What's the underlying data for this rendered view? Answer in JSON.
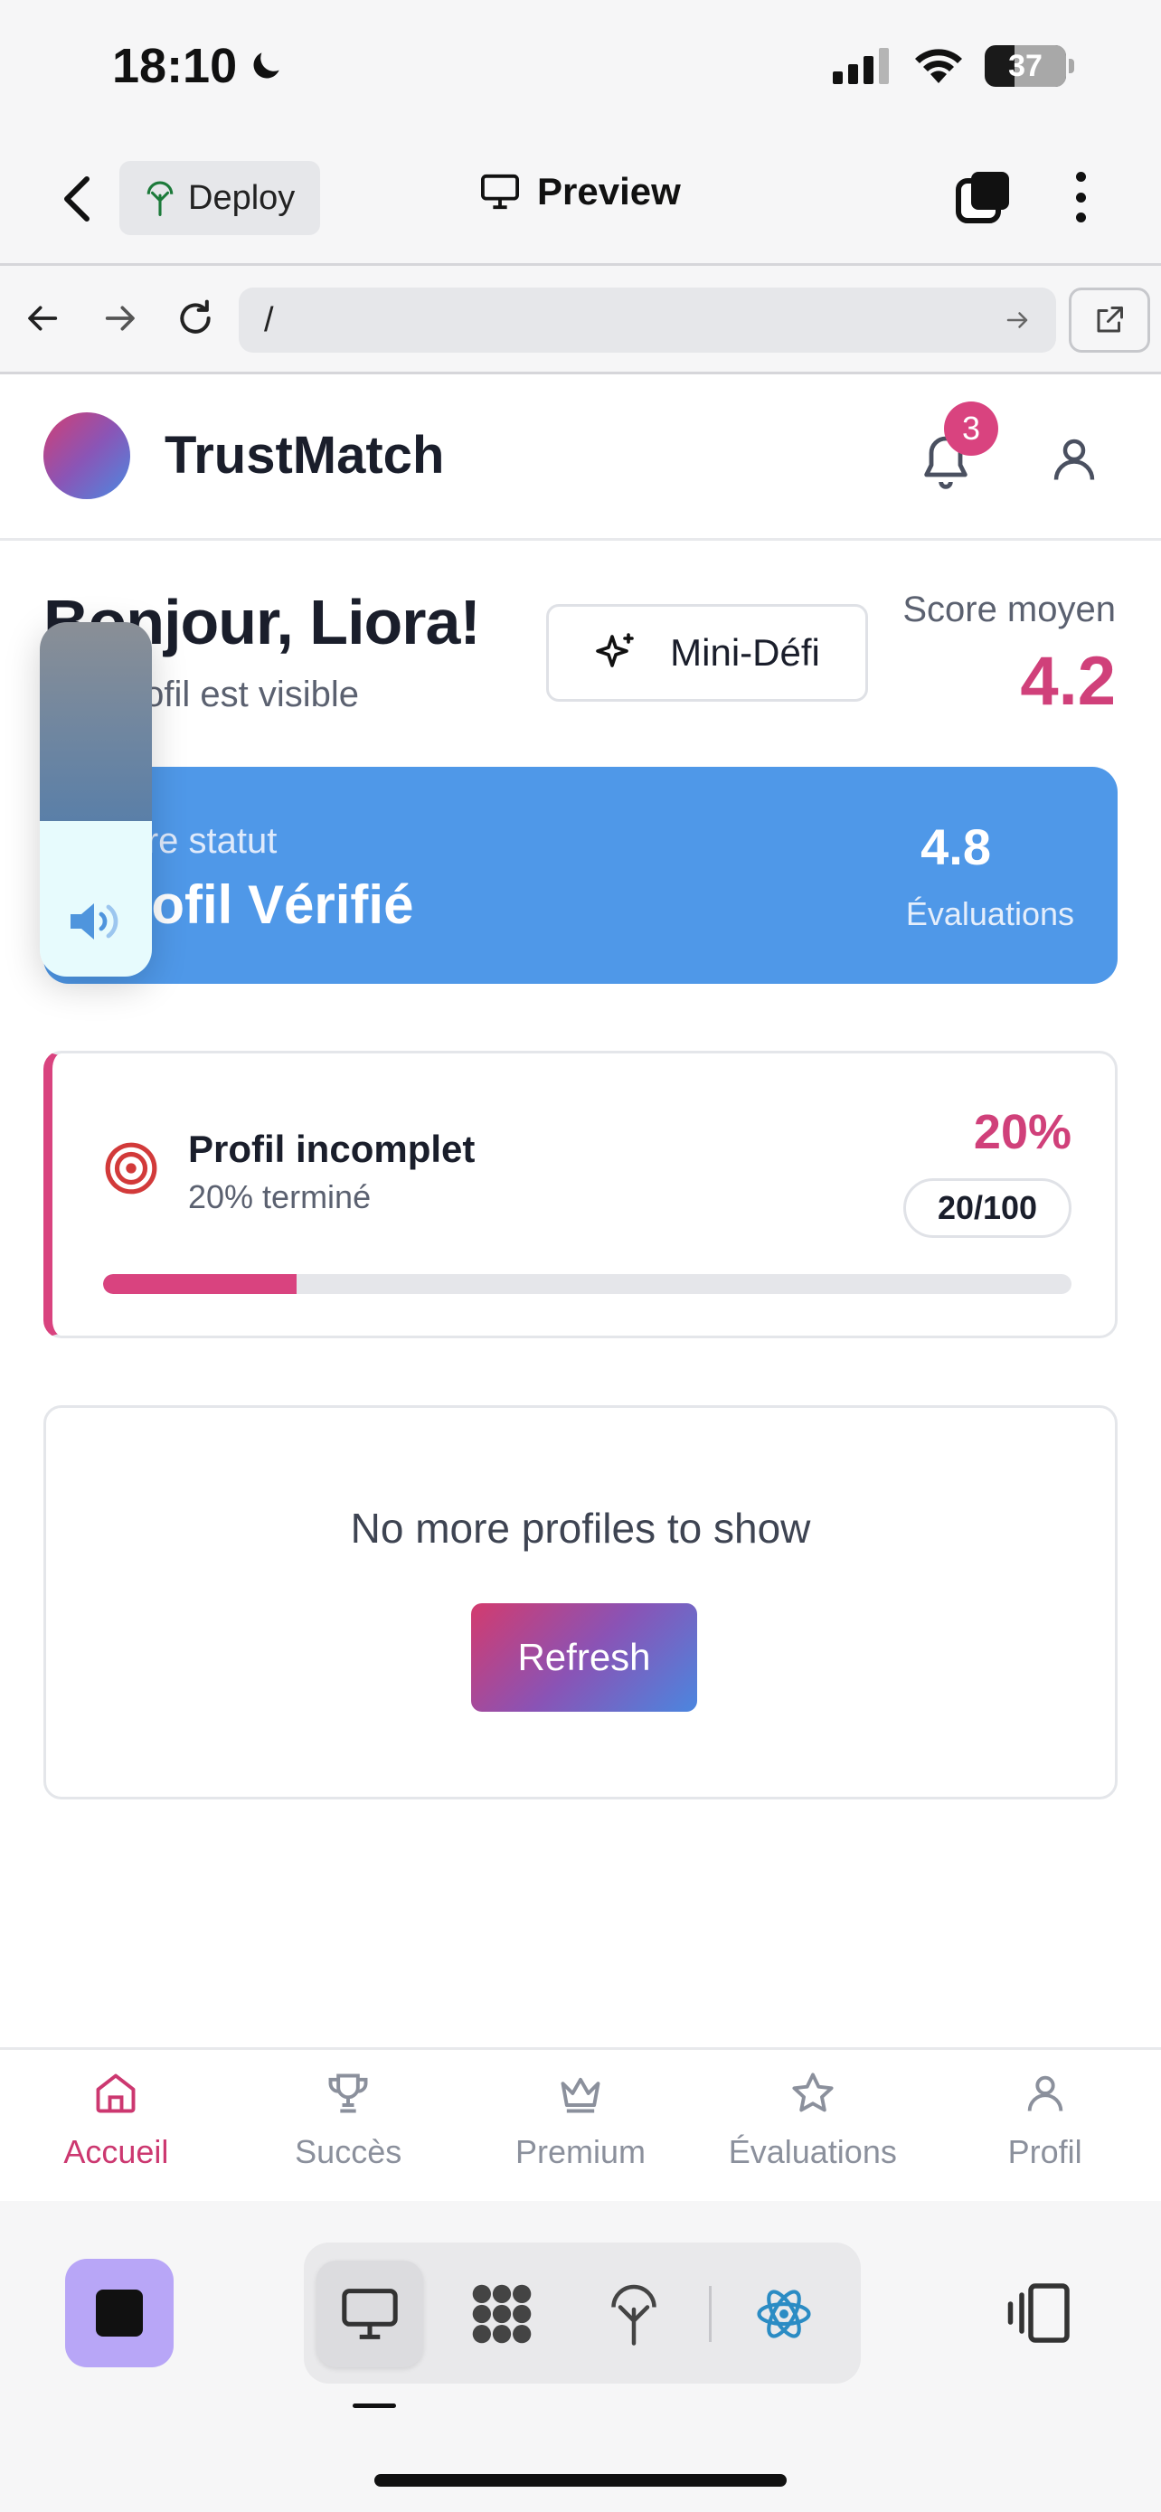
{
  "status_bar": {
    "time": "18:10",
    "battery": "37",
    "battery_level": 0.37
  },
  "header": {
    "deploy_label": "Deploy",
    "title": "Preview"
  },
  "browser": {
    "url": "/"
  },
  "app": {
    "brand": "TrustMatch",
    "notification_count": "3",
    "greeting": "Bonjour, Liora!",
    "greeting_sub": "Ton profil est visible",
    "mini_defi": "Mini-Défi",
    "score_label": "Score moyen",
    "score_value": "4.2",
    "status_card": {
      "label": "Votre statut",
      "value": "Profil Vérifié",
      "rating": "4.8",
      "rating_label": "Évaluations"
    },
    "progress": {
      "title": "Profil incomplet",
      "subtitle": "20% terminé",
      "percent": "20%",
      "chip": "20/100",
      "fraction": 0.2
    },
    "empty": {
      "text": "No more profiles to show",
      "button": "Refresh"
    }
  },
  "volume_hud": {
    "level": 0.44
  },
  "tabs": [
    {
      "label": "Accueil",
      "icon": "home-icon",
      "active": true
    },
    {
      "label": "Succès",
      "icon": "trophy-icon"
    },
    {
      "label": "Premium",
      "icon": "crown-icon"
    },
    {
      "label": "Évaluations",
      "icon": "star-icon"
    },
    {
      "label": "Profil",
      "icon": "user-icon"
    }
  ],
  "colors": {
    "accent_pink": "#d9437f",
    "status_blue": "#4f98e8",
    "stop_purple": "#b8a6f7"
  }
}
